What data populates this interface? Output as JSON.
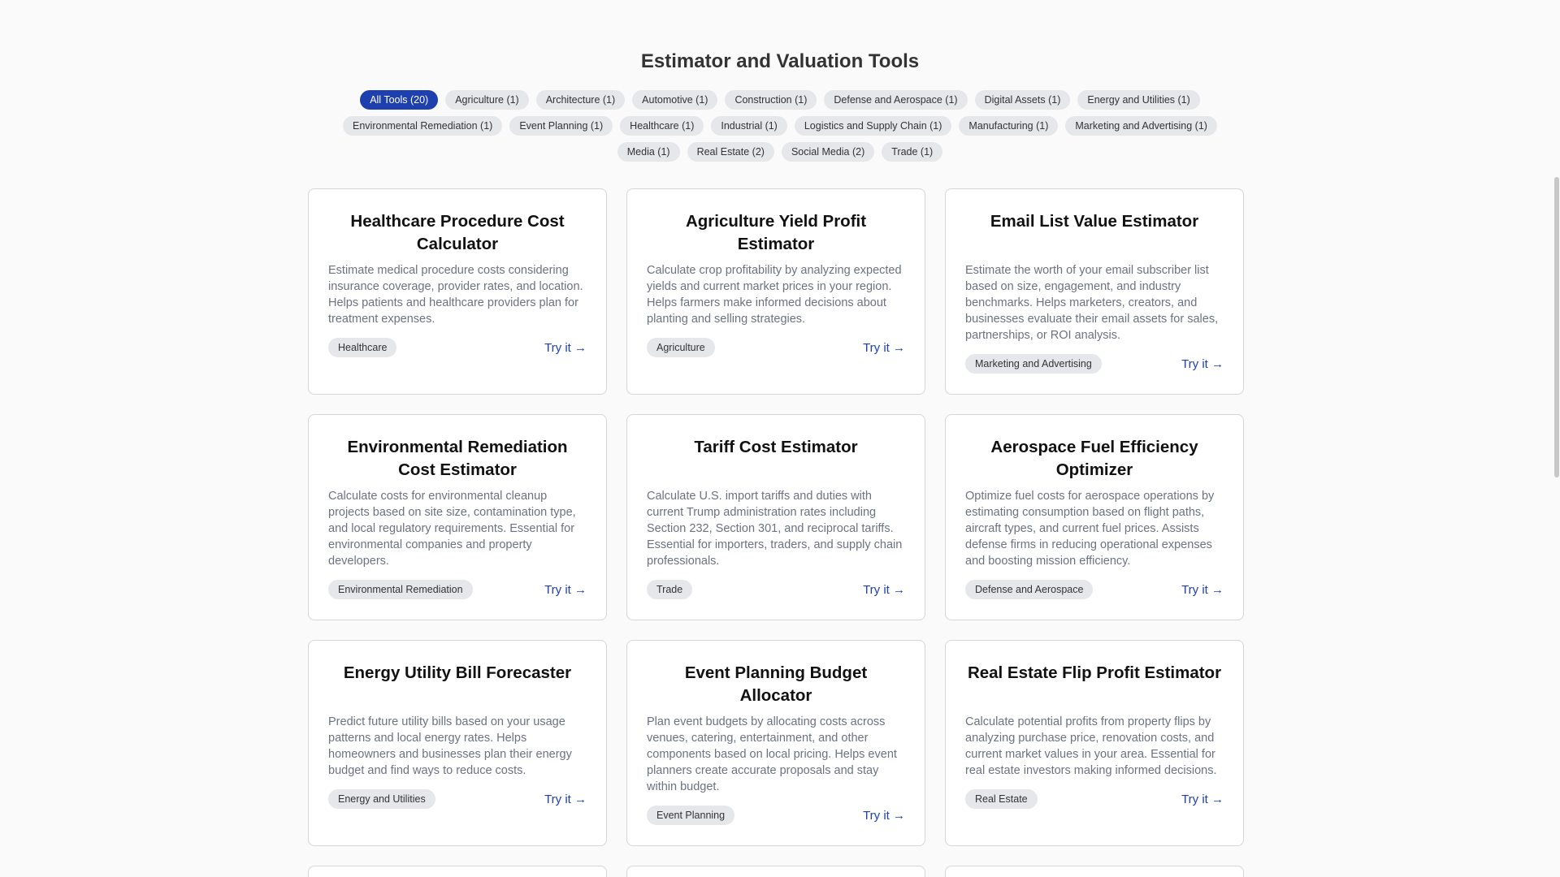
{
  "page": {
    "title": "Estimator and Valuation Tools"
  },
  "filters": [
    {
      "label": "All Tools (20)",
      "active": true
    },
    {
      "label": "Agriculture (1)"
    },
    {
      "label": "Architecture (1)"
    },
    {
      "label": "Automotive (1)"
    },
    {
      "label": "Construction (1)"
    },
    {
      "label": "Defense and Aerospace (1)"
    },
    {
      "label": "Digital Assets (1)"
    },
    {
      "label": "Energy and Utilities (1)"
    },
    {
      "label": "Environmental Remediation (1)"
    },
    {
      "label": "Event Planning (1)"
    },
    {
      "label": "Healthcare (1)"
    },
    {
      "label": "Industrial (1)"
    },
    {
      "label": "Logistics and Supply Chain (1)"
    },
    {
      "label": "Manufacturing (1)"
    },
    {
      "label": "Marketing and Advertising (1)"
    },
    {
      "label": "Media (1)"
    },
    {
      "label": "Real Estate (2)"
    },
    {
      "label": "Social Media (2)"
    },
    {
      "label": "Trade (1)"
    }
  ],
  "cards": [
    {
      "title": "Healthcare Procedure Cost Calculator",
      "description": "Estimate medical procedure costs considering insurance coverage, provider rates, and location. Helps patients and healthcare providers plan for treatment expenses.",
      "tag": "Healthcare",
      "cta": "Try it →"
    },
    {
      "title": "Agriculture Yield Profit Estimator",
      "description": "Calculate crop profitability by analyzing expected yields and current market prices in your region. Helps farmers make informed decisions about planting and selling strategies.",
      "tag": "Agriculture",
      "cta": "Try it →"
    },
    {
      "title": "Email List Value Estimator",
      "description": "Estimate the worth of your email subscriber list based on size, engagement, and industry benchmarks. Helps marketers, creators, and businesses evaluate their email assets for sales, partnerships, or ROI analysis.",
      "tag": "Marketing and Advertising",
      "cta": "Try it →"
    },
    {
      "title": "Environmental Remediation Cost Estimator",
      "description": "Calculate costs for environmental cleanup projects based on site size, contamination type, and local regulatory requirements. Essential for environmental companies and property developers.",
      "tag": "Environmental Remediation",
      "cta": "Try it →"
    },
    {
      "title": "Tariff Cost Estimator",
      "description": "Calculate U.S. import tariffs and duties with current Trump administration rates including Section 232, Section 301, and reciprocal tariffs. Essential for importers, traders, and supply chain professionals.",
      "tag": "Trade",
      "cta": "Try it →"
    },
    {
      "title": "Aerospace Fuel Efficiency Optimizer",
      "description": "Optimize fuel costs for aerospace operations by estimating consumption based on flight paths, aircraft types, and current fuel prices. Assists defense firms in reducing operational expenses and boosting mission efficiency.",
      "tag": "Defense and Aerospace",
      "cta": "Try it →"
    },
    {
      "title": "Energy Utility Bill Forecaster",
      "description": "Predict future utility bills based on your usage patterns and local energy rates. Helps homeowners and businesses plan their energy budget and find ways to reduce costs.",
      "tag": "Energy and Utilities",
      "cta": "Try it →"
    },
    {
      "title": "Event Planning Budget Allocator",
      "description": "Plan event budgets by allocating costs across venues, catering, entertainment, and other components based on local pricing. Helps event planners create accurate proposals and stay within budget.",
      "tag": "Event Planning",
      "cta": "Try it →"
    },
    {
      "title": "Real Estate Flip Profit Estimator",
      "description": "Calculate potential profits from property flips by analyzing purchase price, renovation costs, and current market values in your area. Essential for real estate investors making informed decisions.",
      "tag": "Real Estate",
      "cta": "Try it →"
    }
  ]
}
